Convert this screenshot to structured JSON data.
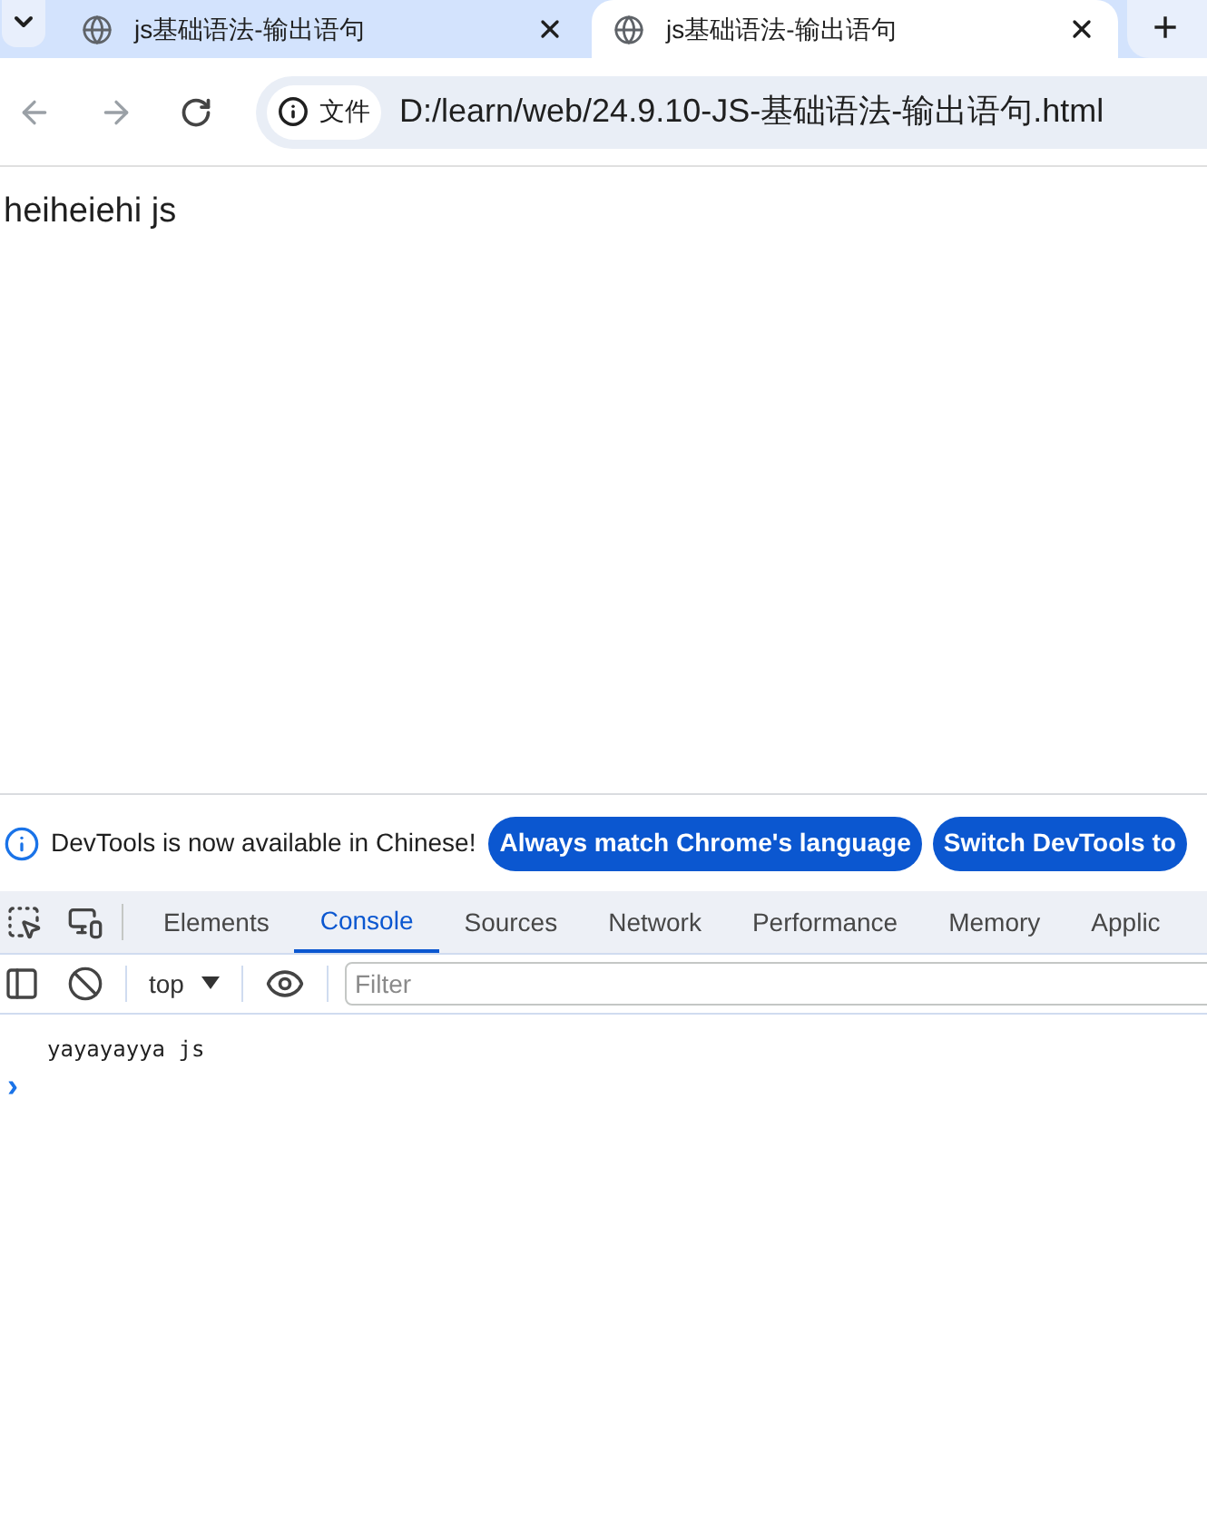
{
  "tabs": [
    {
      "title": "js基础语法-输出语句",
      "selected": false
    },
    {
      "title": "js基础语法-输出语句",
      "selected": true
    }
  ],
  "new_tab": "+",
  "address_bar": {
    "chip": "文件",
    "url": "D:/learn/web/24.9.10-JS-基础语法-输出语句.html"
  },
  "page": {
    "text": "heiheiehi js"
  },
  "devtools": {
    "notice": {
      "text": "DevTools is now available in Chinese!",
      "buttons": [
        "Always match Chrome's language",
        "Switch DevTools to"
      ]
    },
    "panels": [
      {
        "label": "Elements",
        "selected": false
      },
      {
        "label": "Console",
        "selected": true
      },
      {
        "label": "Sources",
        "selected": false
      },
      {
        "label": "Network",
        "selected": false
      },
      {
        "label": "Performance",
        "selected": false
      },
      {
        "label": "Memory",
        "selected": false
      },
      {
        "label": "Applic",
        "selected": false
      }
    ],
    "context": "top",
    "filter": {
      "placeholder": "Filter"
    },
    "console": {
      "messages": [
        "yayayayya js"
      ],
      "prompt": "›"
    }
  }
}
